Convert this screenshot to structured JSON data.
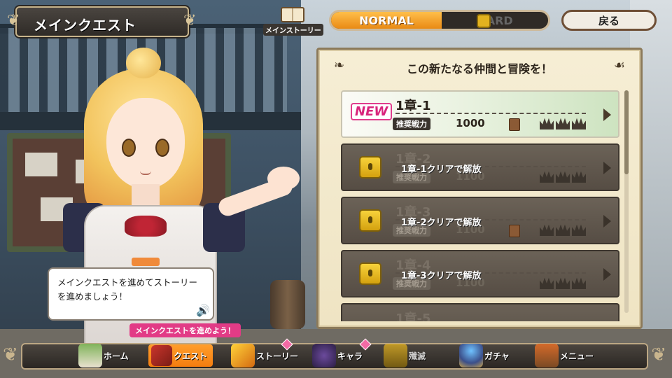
{
  "header": {
    "title": "メインクエスト",
    "story_label": "メインストーリー",
    "difficulty": {
      "normal": "NORMAL",
      "hard": "HARD",
      "selected": "NORMAL"
    },
    "back": "戻る"
  },
  "panel": {
    "heading": "この新たなる仲間と冒険を！",
    "quests": [
      {
        "chapter": "1章-1",
        "tag": "NEW",
        "badge": "推奨戦力",
        "power": "1000",
        "locked": false,
        "crowns": 3
      },
      {
        "chapter": "1章-2",
        "badge": "推奨戦力",
        "power": "1100",
        "locked": true,
        "unlock": "1章-1クリアで解放",
        "crowns": 3
      },
      {
        "chapter": "1章-3",
        "badge": "推奨戦力",
        "power": "1100",
        "locked": true,
        "unlock": "1章-2クリアで解放",
        "crowns": 3
      },
      {
        "chapter": "1章-4",
        "badge": "推奨戦力",
        "power": "1100",
        "locked": true,
        "unlock": "1章-3クリアで解放",
        "crowns": 3
      },
      {
        "chapter": "1章-5",
        "locked": true
      }
    ]
  },
  "bubble": {
    "text": "メインクエストを進めてストーリーを進めましょう！"
  },
  "tip": "メインクエストを進めよう！",
  "nav": {
    "home": "ホーム",
    "quest": "クエスト",
    "story": "ストーリー",
    "chara": "キャラ",
    "subjugation": "殲滅",
    "gacha": "ガチャ",
    "menu": "メニュー",
    "active": "クエスト"
  }
}
